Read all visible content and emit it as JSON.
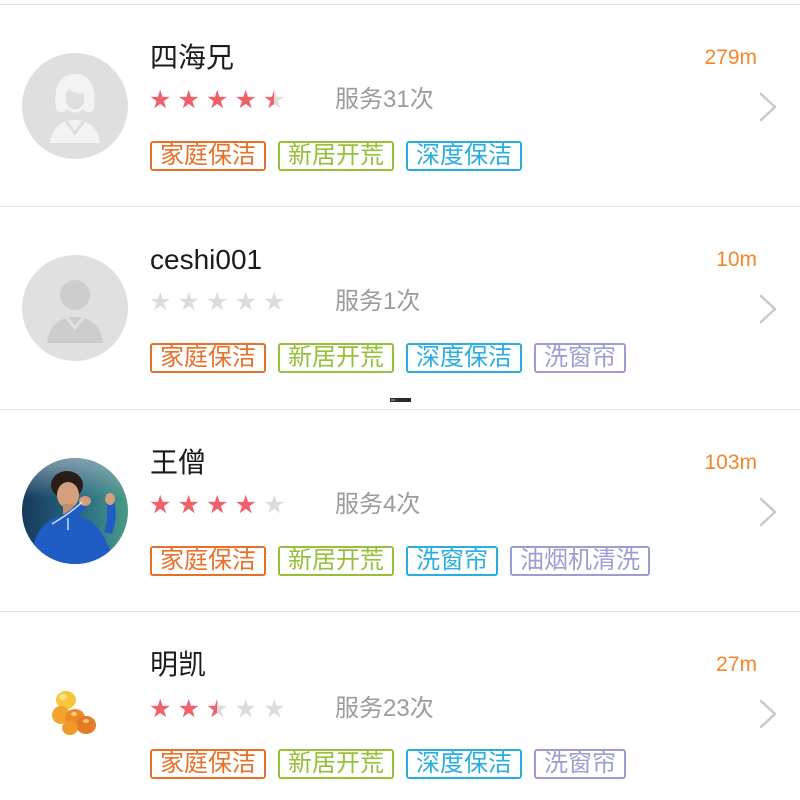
{
  "theme": {
    "distance_color": "#f4852b",
    "star_filled": "#f0616b",
    "star_empty": "#dcdcdc",
    "divider_color": "#e4e4e4"
  },
  "workers": [
    {
      "name": "四海兄",
      "distance": "279m",
      "rating": 4.5,
      "service_count": "服务31次",
      "avatar": "female-avatar-placeholder-icon",
      "tags": [
        {
          "label": "家庭保洁",
          "color": "#e8702a"
        },
        {
          "label": "新居开荒",
          "color": "#97c03a"
        },
        {
          "label": "深度保洁",
          "color": "#2aaee0"
        }
      ]
    },
    {
      "name": "ceshi001",
      "distance": "10m",
      "rating": 0,
      "service_count": "服务1次",
      "avatar": "person-avatar-placeholder-icon",
      "tags": [
        {
          "label": "家庭保洁",
          "color": "#e8702a"
        },
        {
          "label": "新居开荒",
          "color": "#97c03a"
        },
        {
          "label": "深度保洁",
          "color": "#2aaee0"
        },
        {
          "label": "洗窗帘",
          "color": "#9a9ed2"
        }
      ]
    },
    {
      "name": "王僧",
      "distance": "103m",
      "rating": 4,
      "service_count": "服务4次",
      "avatar": "user-photo-avatar",
      "tags": [
        {
          "label": "家庭保洁",
          "color": "#e8702a"
        },
        {
          "label": "新居开荒",
          "color": "#97c03a"
        },
        {
          "label": "洗窗帘",
          "color": "#2aaee0"
        },
        {
          "label": "油烟机清洗",
          "color": "#9a9ed2"
        }
      ]
    },
    {
      "name": "明凯",
      "distance": "27m",
      "rating": 2.5,
      "service_count": "服务23次",
      "avatar": "food-photo-avatar",
      "tags": [
        {
          "label": "家庭保洁",
          "color": "#e8702a"
        },
        {
          "label": "新居开荒",
          "color": "#97c03a"
        },
        {
          "label": "深度保洁",
          "color": "#2aaee0"
        },
        {
          "label": "洗窗帘",
          "color": "#9a9ed2"
        }
      ]
    }
  ]
}
